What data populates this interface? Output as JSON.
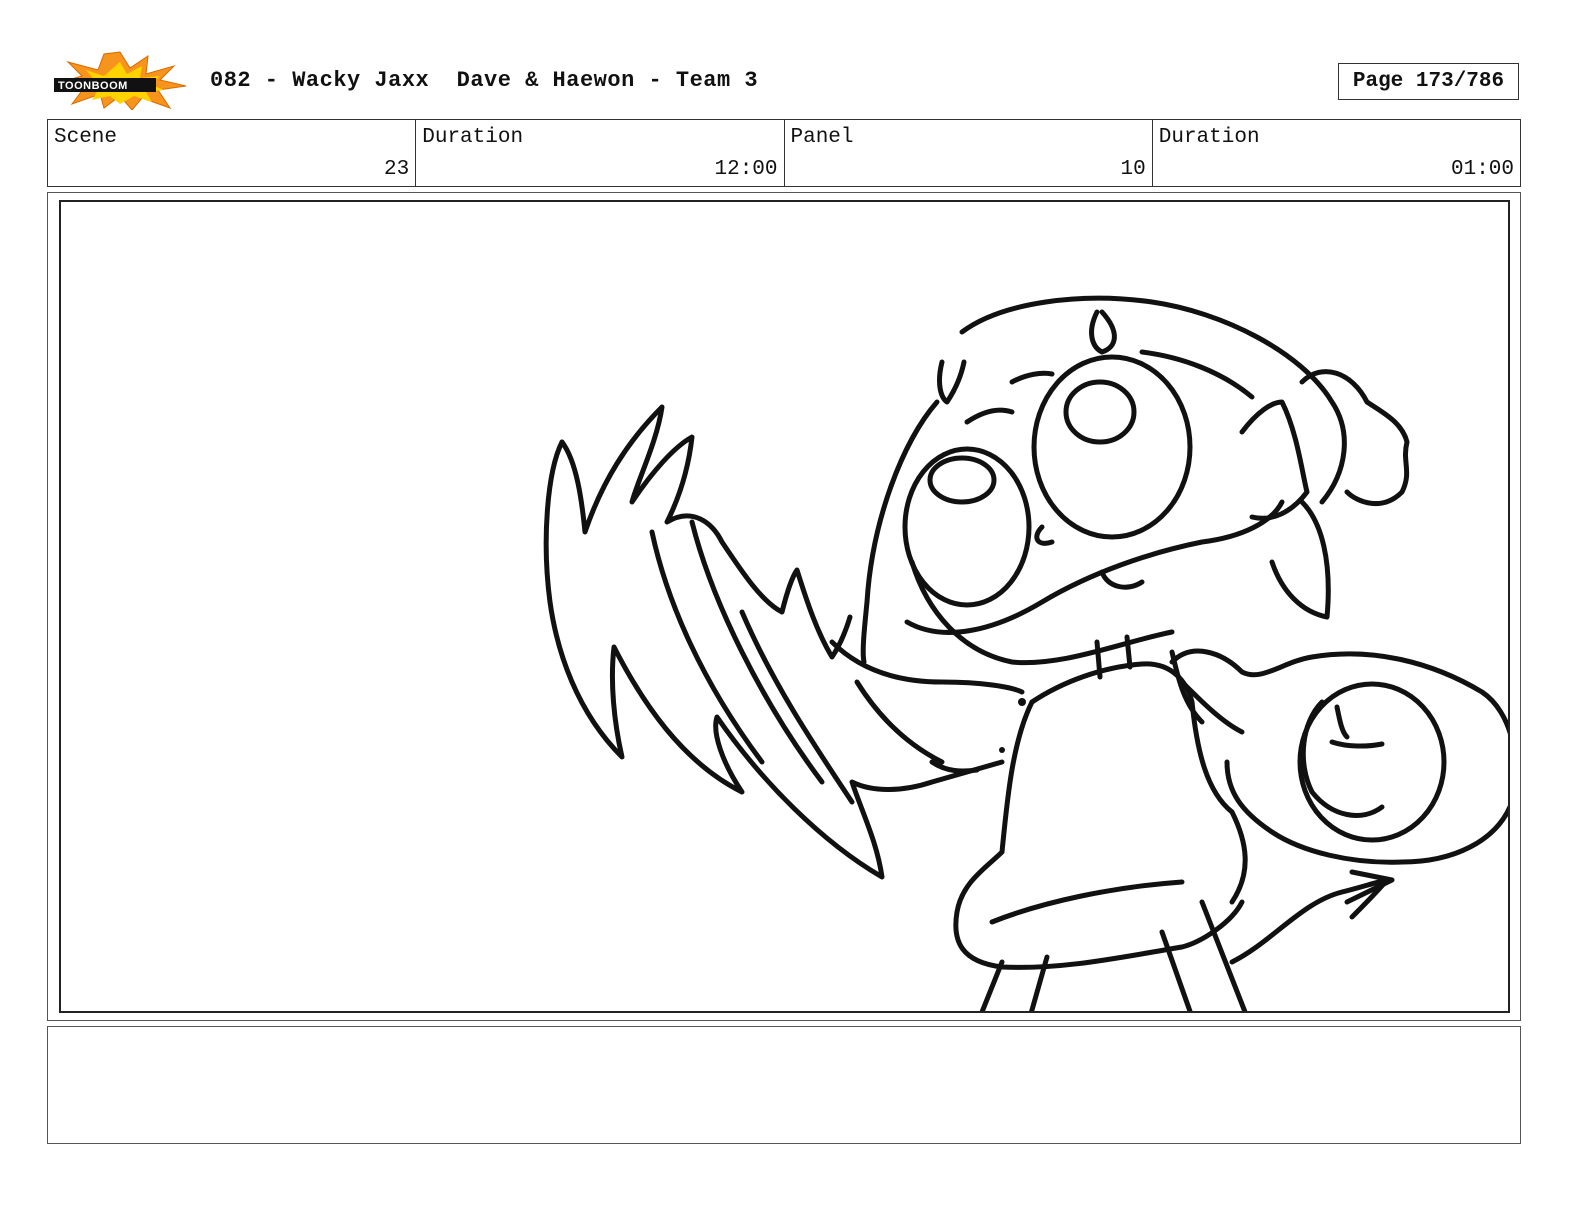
{
  "header": {
    "logo_text": "TOONBOOM",
    "title": "082 - Wacky Jaxx  Dave & Haewon - Team 3",
    "page": "Page 173/786"
  },
  "info": [
    {
      "label": "Scene",
      "value": "23"
    },
    {
      "label": "Duration",
      "value": "12:00"
    },
    {
      "label": "Panel",
      "value": "10"
    },
    {
      "label": "Duration",
      "value": "01:00"
    }
  ],
  "panel": {
    "image": "storyboard-sketch-character-reaching"
  },
  "notes": {
    "text": ""
  },
  "colors": {
    "logo_orange": "#f7941d",
    "logo_yellow": "#ffd200",
    "ink": "#111111"
  }
}
